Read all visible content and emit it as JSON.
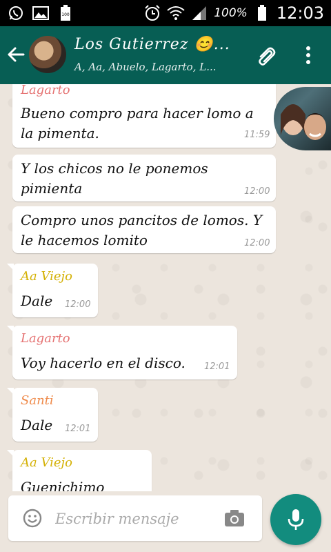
{
  "status_bar": {
    "icons": [
      "whatsapp-icon",
      "image-icon",
      "battery-full-small-icon",
      "alarm-icon",
      "wifi-icon",
      "signal-icon",
      "battery-icon"
    ],
    "battery_percent": "100%",
    "time": "12:03"
  },
  "header": {
    "back_icon": "arrow-left-icon",
    "title": "Los Gutierrez 😊...",
    "subtitle": "A, Aa, Abuelo, Lagarto, L...",
    "attach_icon": "paperclip-icon",
    "menu_icon": "more-vert-icon"
  },
  "messages": [
    {
      "sender": "Lagarto",
      "sender_color": "#e57373",
      "lines": [
        "Bueno compro para hacer lomo a",
        "la pimenta."
      ],
      "time": "11:59"
    },
    {
      "sender": "",
      "lines": [
        "Y los chicos no le ponemos",
        "pimienta"
      ],
      "time": "12:00"
    },
    {
      "sender": "",
      "lines": [
        "Compro unos pancitos de lomos. Y",
        "le hacemos lomito"
      ],
      "time": "12:00"
    },
    {
      "sender": "Aa Viejo",
      "sender_color": "#d4b106",
      "lines": [
        "Dale"
      ],
      "time": "12:00"
    },
    {
      "sender": "Lagarto",
      "sender_color": "#e57373",
      "lines": [
        "Voy hacerlo en el disco."
      ],
      "time": "12:01"
    },
    {
      "sender": "Santi",
      "sender_color": "#ef8a4a",
      "lines": [
        "Dale"
      ],
      "time": "12:01"
    },
    {
      "sender": "Aa Viejo",
      "sender_color": "#d4b106",
      "lines": [
        "Guenichimo"
      ],
      "time": ""
    }
  ],
  "composer": {
    "emoji_icon": "emoji-icon",
    "placeholder": "Escribir mensaje",
    "camera_icon": "camera-icon",
    "mic_icon": "mic-icon"
  },
  "colors": {
    "header": "#075e54",
    "mic": "#128c7e",
    "chat_bg": "#ece5dd"
  }
}
